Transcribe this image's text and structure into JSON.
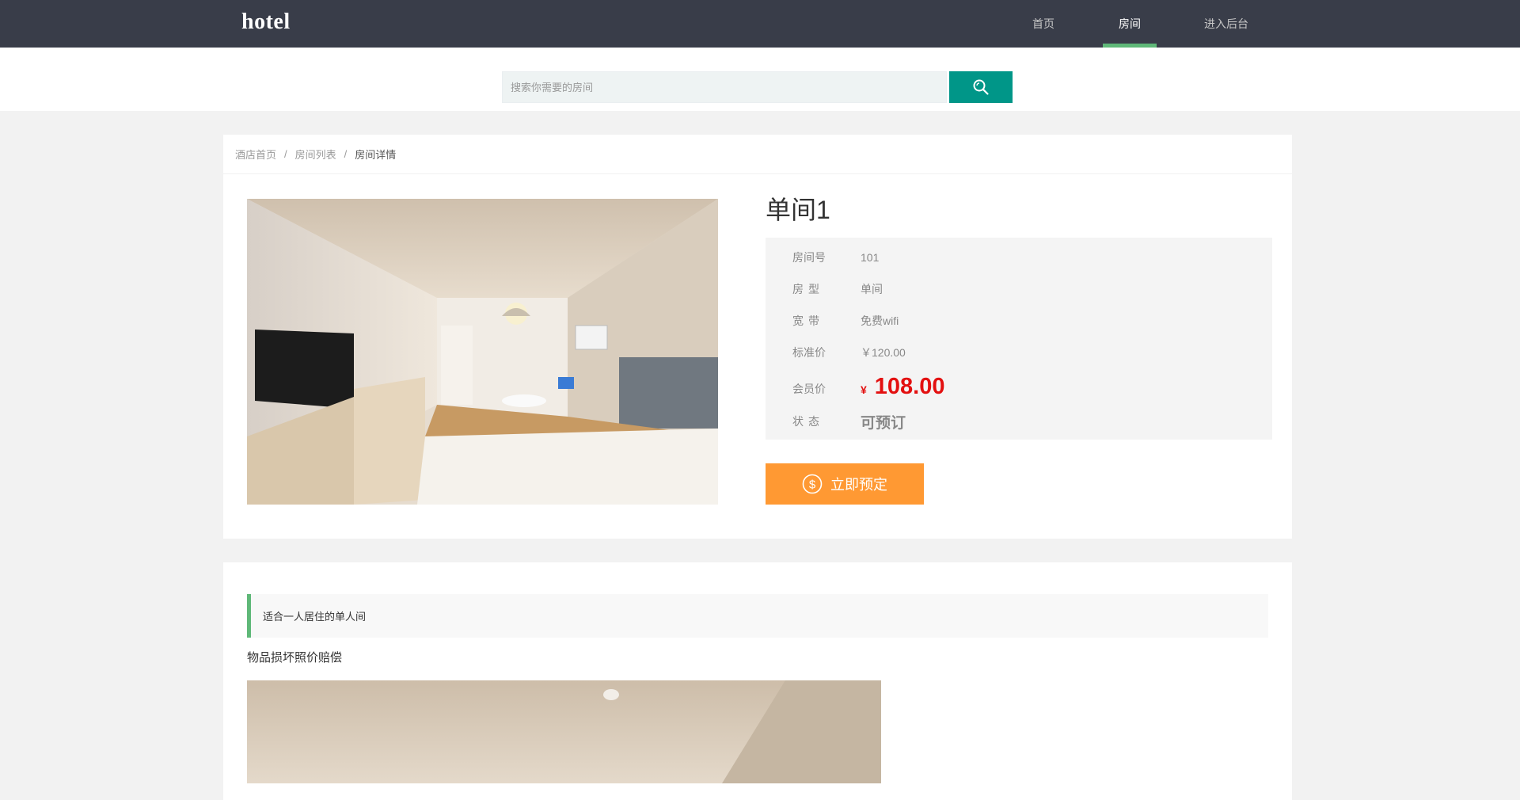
{
  "header": {
    "logo": "hotel",
    "nav": [
      {
        "label": "首页",
        "active": false
      },
      {
        "label": "房间",
        "active": true
      },
      {
        "label": "进入后台",
        "active": false
      }
    ],
    "accent": "#5fb878",
    "background": "#393d49"
  },
  "search": {
    "placeholder": "搜索你需要的房间",
    "button_icon": "search-icon",
    "button_color": "#009688"
  },
  "breadcrumb": {
    "items": [
      "酒店首页",
      "房间列表",
      "房间详情"
    ],
    "separator": "/"
  },
  "room": {
    "title": "单间1",
    "fields": {
      "number_label": "房间号",
      "number": "101",
      "type_label": [
        "房",
        "型"
      ],
      "type": "单间",
      "broadband_label": [
        "宽",
        "带"
      ],
      "broadband": "免费wifi",
      "standard_price_label": "标准价",
      "standard_price": "￥120.00",
      "member_price_label": "会员价",
      "member_currency": "¥",
      "member_price": "108.00",
      "status_label": [
        "状",
        "态"
      ],
      "status": "可预订"
    },
    "price_color": "#e31010",
    "status_color": "#2fc13a",
    "book_button": {
      "label": "立即预定",
      "icon": "dollar-circle-icon",
      "color": "#ff9933"
    }
  },
  "description": {
    "quote": "适合一人居住的单人间",
    "note": "物品损坏照价赔偿"
  }
}
